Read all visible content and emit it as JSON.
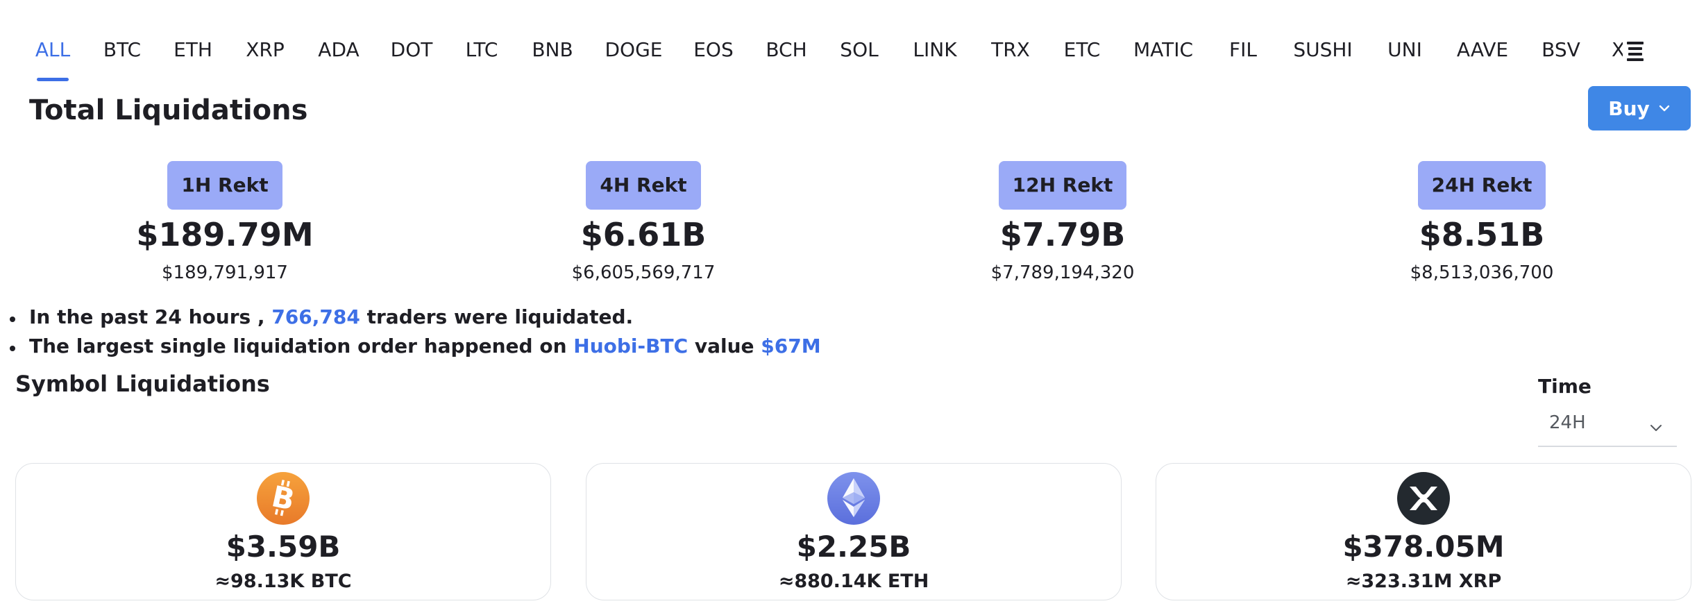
{
  "tabs": [
    "ALL",
    "BTC",
    "ETH",
    "XRP",
    "ADA",
    "DOT",
    "LTC",
    "BNB",
    "DOGE",
    "EOS",
    "BCH",
    "SOL",
    "LINK",
    "TRX",
    "ETC",
    "MATIC",
    "FIL",
    "SUSHI",
    "UNI",
    "AAVE",
    "BSV"
  ],
  "active_tab": "ALL",
  "tab_more_partial": "X",
  "page_title": "Total Liquidations",
  "buy_button": "Buy",
  "stats": [
    {
      "badge": "1H Rekt",
      "value": "$189.79M",
      "exact": "$189,791,917"
    },
    {
      "badge": "4H Rekt",
      "value": "$6.61B",
      "exact": "$6,605,569,717"
    },
    {
      "badge": "12H Rekt",
      "value": "$7.79B",
      "exact": "$7,789,194,320"
    },
    {
      "badge": "24H Rekt",
      "value": "$8.51B",
      "exact": "$8,513,036,700"
    }
  ],
  "bullets": {
    "line1_prefix": "In the past 24 hours , ",
    "line1_count": "766,784",
    "line1_suffix": " traders were liquidated.",
    "line2_prefix": "The largest single liquidation order happened on ",
    "line2_exchange": "Huobi-BTC",
    "line2_mid": " value ",
    "line2_value": "$67M"
  },
  "section_title": "Symbol Liquidations",
  "time_filter": {
    "label": "Time",
    "value": "24H"
  },
  "coins": [
    {
      "icon": "bitcoin-icon",
      "value": "$3.59B",
      "amount": "≈98.13K BTC"
    },
    {
      "icon": "ethereum-icon",
      "value": "$2.25B",
      "amount": "≈880.14K ETH"
    },
    {
      "icon": "xrp-icon",
      "value": "$378.05M",
      "amount": "≈323.31M XRP"
    }
  ],
  "colors": {
    "accent": "#3d6fe6",
    "badge": "#9aaaf7",
    "buy": "#3f87e6"
  }
}
